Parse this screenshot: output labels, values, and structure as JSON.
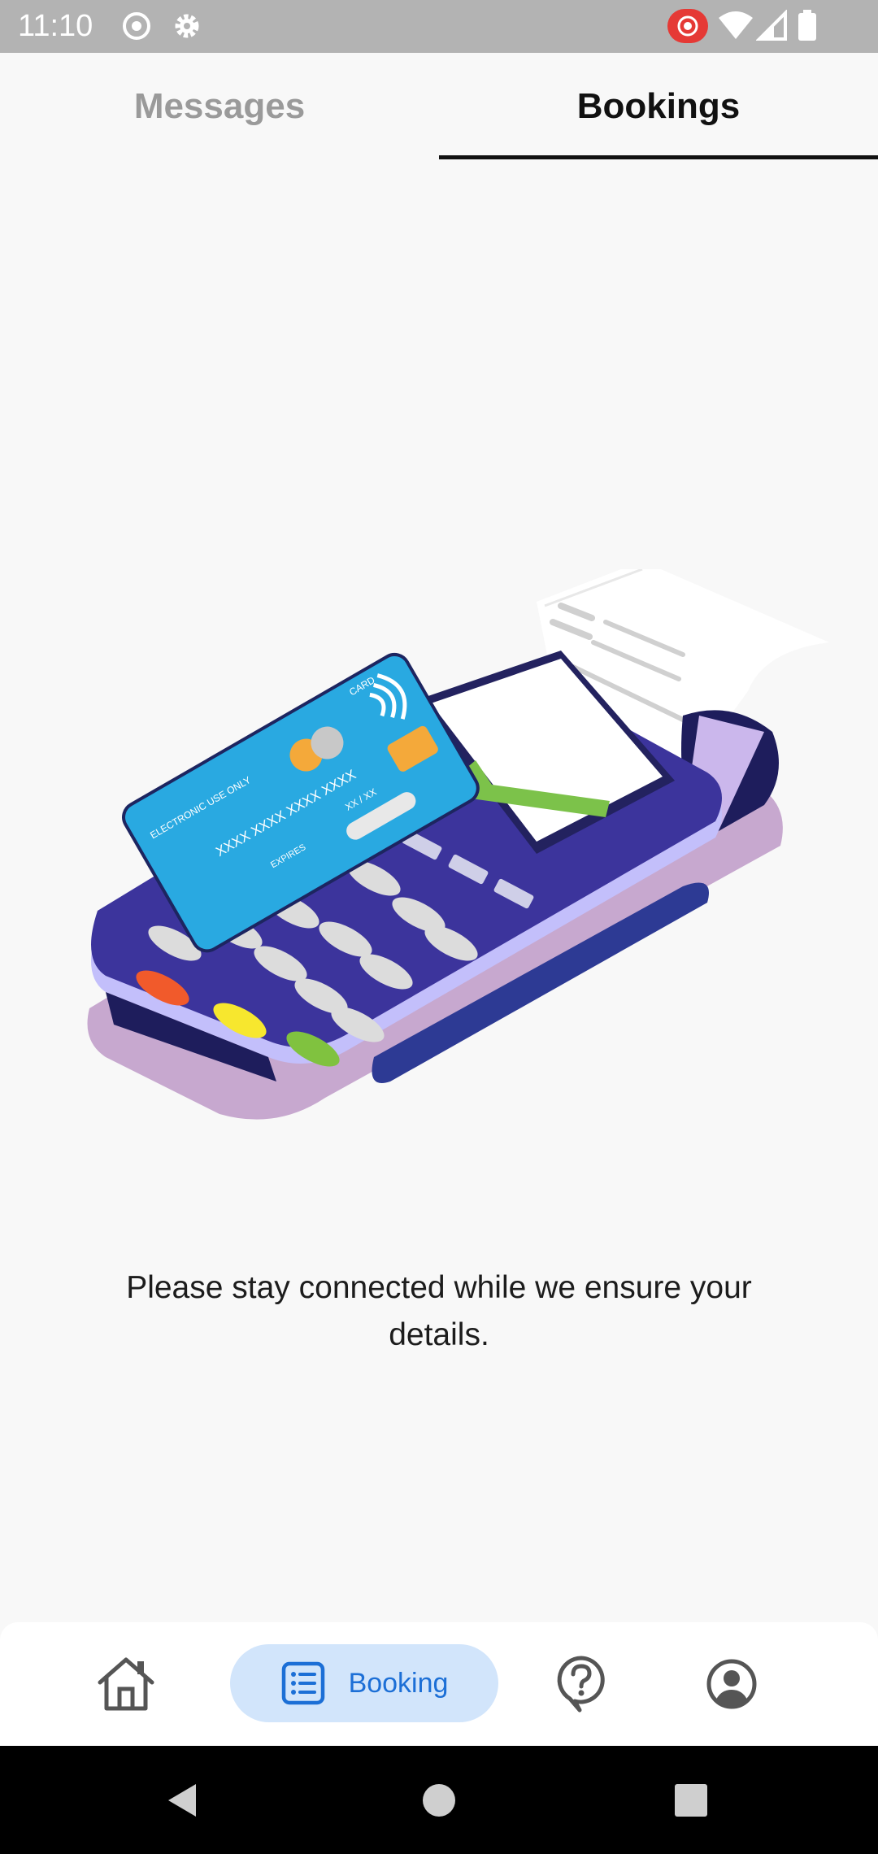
{
  "status_bar": {
    "time": "11:10",
    "icons": [
      "screen-record-icon",
      "settings-icon",
      "cast-recording-icon",
      "wifi-icon",
      "signal-icon",
      "battery-icon"
    ]
  },
  "tabs": [
    {
      "label": "Messages",
      "active": false
    },
    {
      "label": "Bookings",
      "active": true
    }
  ],
  "illustration": {
    "card": {
      "type_text": "CARD",
      "usage_text": "ELECTRONIC USE ONLY",
      "number_text": "XXXX XXXX XXXX XXXX",
      "expiry_text": "XX / XX",
      "expires_label": "EXPIRES"
    }
  },
  "message": "Please stay connected while we ensure your details.",
  "bottom_nav": {
    "items": [
      {
        "name": "home",
        "icon": "home-icon",
        "label": "",
        "active": false
      },
      {
        "name": "booking",
        "icon": "list-icon",
        "label": "Booking",
        "active": true
      },
      {
        "name": "help",
        "icon": "help-chat-icon",
        "label": "",
        "active": false
      },
      {
        "name": "profile",
        "icon": "profile-icon",
        "label": "",
        "active": false
      }
    ],
    "active_color": "#1c6fd6",
    "active_bg": "#d2e5fb"
  },
  "system_nav": [
    "back-icon",
    "home-circle-icon",
    "recents-icon"
  ]
}
